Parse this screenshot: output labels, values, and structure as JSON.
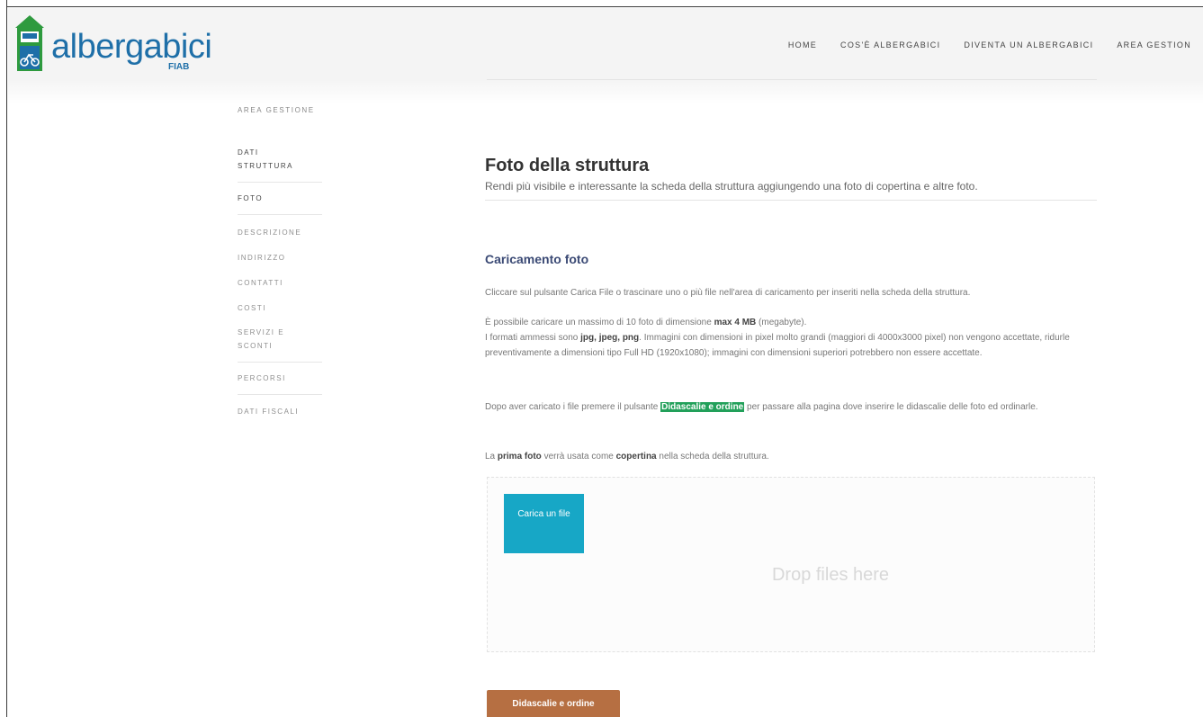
{
  "brand": {
    "logo_text": "albergabici",
    "logo_sub": "FIAB",
    "colors": {
      "primary": "#1e6fa8",
      "green": "#2e9a3e"
    }
  },
  "nav": {
    "items": [
      {
        "label": "HOME"
      },
      {
        "label": "COS'È ALBERGABICI"
      },
      {
        "label": "DIVENTA UN ALBERGABICI"
      },
      {
        "label": "AREA GESTION"
      }
    ]
  },
  "sidebar": {
    "heading": "AREA GESTIONE",
    "items": [
      {
        "label": "DATI STRUTTURA"
      },
      {
        "label": "FOTO"
      },
      {
        "label": "DESCRIZIONE"
      },
      {
        "label": "INDIRIZZO"
      },
      {
        "label": "CONTATTI"
      },
      {
        "label": "COSTI"
      },
      {
        "label": "SERVIZI E SCONTI"
      },
      {
        "label": "PERCORSI"
      },
      {
        "label": "DATI FISCALI"
      }
    ]
  },
  "main": {
    "title": "Foto della struttura",
    "subtitle": "Rendi più visibile e interessante la scheda della struttura aggiungendo una foto di copertina e altre foto.",
    "section_title": "Caricamento foto",
    "p1": "Cliccare sul pulsante Carica File o trascinare uno o più file nell'area di caricamento per inseriti nella scheda della struttura.",
    "p2_a": "È possibile caricare un massimo di 10 foto di dimensione ",
    "p2_b": "max 4 MB",
    "p2_c": " (megabyte).",
    "p3_a": "I formati ammessi sono ",
    "p3_b": "jpg, jpeg, png",
    "p3_c": ". Immagini con dimensioni in pixel molto grandi (maggiori di 4000x3000 pixel) non vengono accettate, ridurle preventivamente a dimensioni tipo Full HD (1920x1080); immagini con dimensioni superiori potrebbero non essere accettate.",
    "p4_a": "Dopo aver caricato i file premere il pulsante ",
    "p4_b": "Didascalie e ordine",
    "p4_c": " per passare alla pagina dove inserire le didascalie delle foto ed ordinarle.",
    "p5_a": "La ",
    "p5_b": "prima foto",
    "p5_c": " verrà usata come ",
    "p5_d": "copertina",
    "p5_e": " nella scheda della struttura."
  },
  "upload": {
    "button_label": "Carica un file",
    "drop_text": "Drop files here",
    "color": "#17a7c6"
  },
  "order_button": {
    "label": "Didascalie e ordine",
    "color": "#b66f42"
  }
}
